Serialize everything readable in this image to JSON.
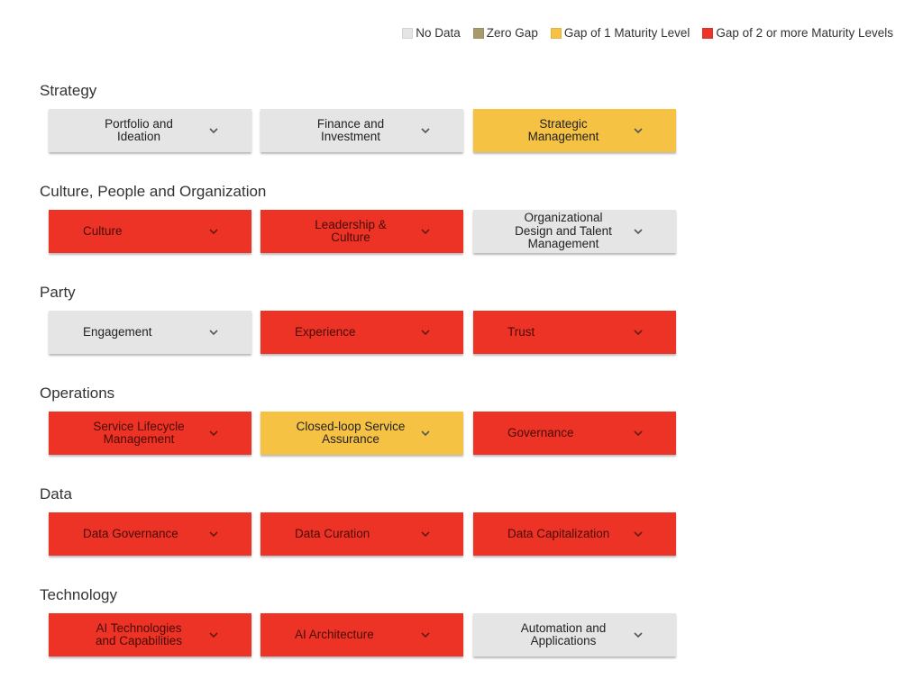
{
  "legend": [
    {
      "label": "No Data",
      "color": "#e5e5e5"
    },
    {
      "label": "Zero Gap",
      "color": "#a89a6a"
    },
    {
      "label": "Gap of 1 Maturity Level",
      "color": "#f6c244"
    },
    {
      "label": "Gap of 2 or more Maturity Levels",
      "color": "#ec3326"
    }
  ],
  "sections": [
    {
      "title": "Strategy",
      "items": [
        {
          "label": "Portfolio and\nIdeation",
          "status": "no-data"
        },
        {
          "label": "Finance and\nInvestment",
          "status": "no-data"
        },
        {
          "label": "Strategic\nManagement",
          "status": "gap-1"
        }
      ]
    },
    {
      "title": "Culture, People and Organization",
      "items": [
        {
          "label": "Culture",
          "status": "gap-2"
        },
        {
          "label": "Leadership &\nCulture",
          "status": "gap-2"
        },
        {
          "label": "Organizational\nDesign and Talent\nManagement",
          "status": "no-data"
        }
      ]
    },
    {
      "title": "Party",
      "items": [
        {
          "label": "Engagement",
          "status": "no-data"
        },
        {
          "label": "Experience",
          "status": "gap-2"
        },
        {
          "label": "Trust",
          "status": "gap-2"
        }
      ]
    },
    {
      "title": "Operations",
      "items": [
        {
          "label": "Service Lifecycle\nManagement",
          "status": "gap-2"
        },
        {
          "label": "Closed-loop Service\nAssurance",
          "status": "gap-1"
        },
        {
          "label": "Governance",
          "status": "gap-2"
        }
      ]
    },
    {
      "title": "Data",
      "items": [
        {
          "label": "Data Governance",
          "status": "gap-2"
        },
        {
          "label": "Data Curation",
          "status": "gap-2"
        },
        {
          "label": "Data Capitalization",
          "status": "gap-2"
        }
      ]
    },
    {
      "title": "Technology",
      "items": [
        {
          "label": "AI Technologies\nand Capabilities",
          "status": "gap-2"
        },
        {
          "label": "AI Architecture",
          "status": "gap-2"
        },
        {
          "label": "Automation and\nApplications",
          "status": "no-data"
        }
      ]
    }
  ],
  "icons": {
    "expand": "chevron-down-icon"
  }
}
